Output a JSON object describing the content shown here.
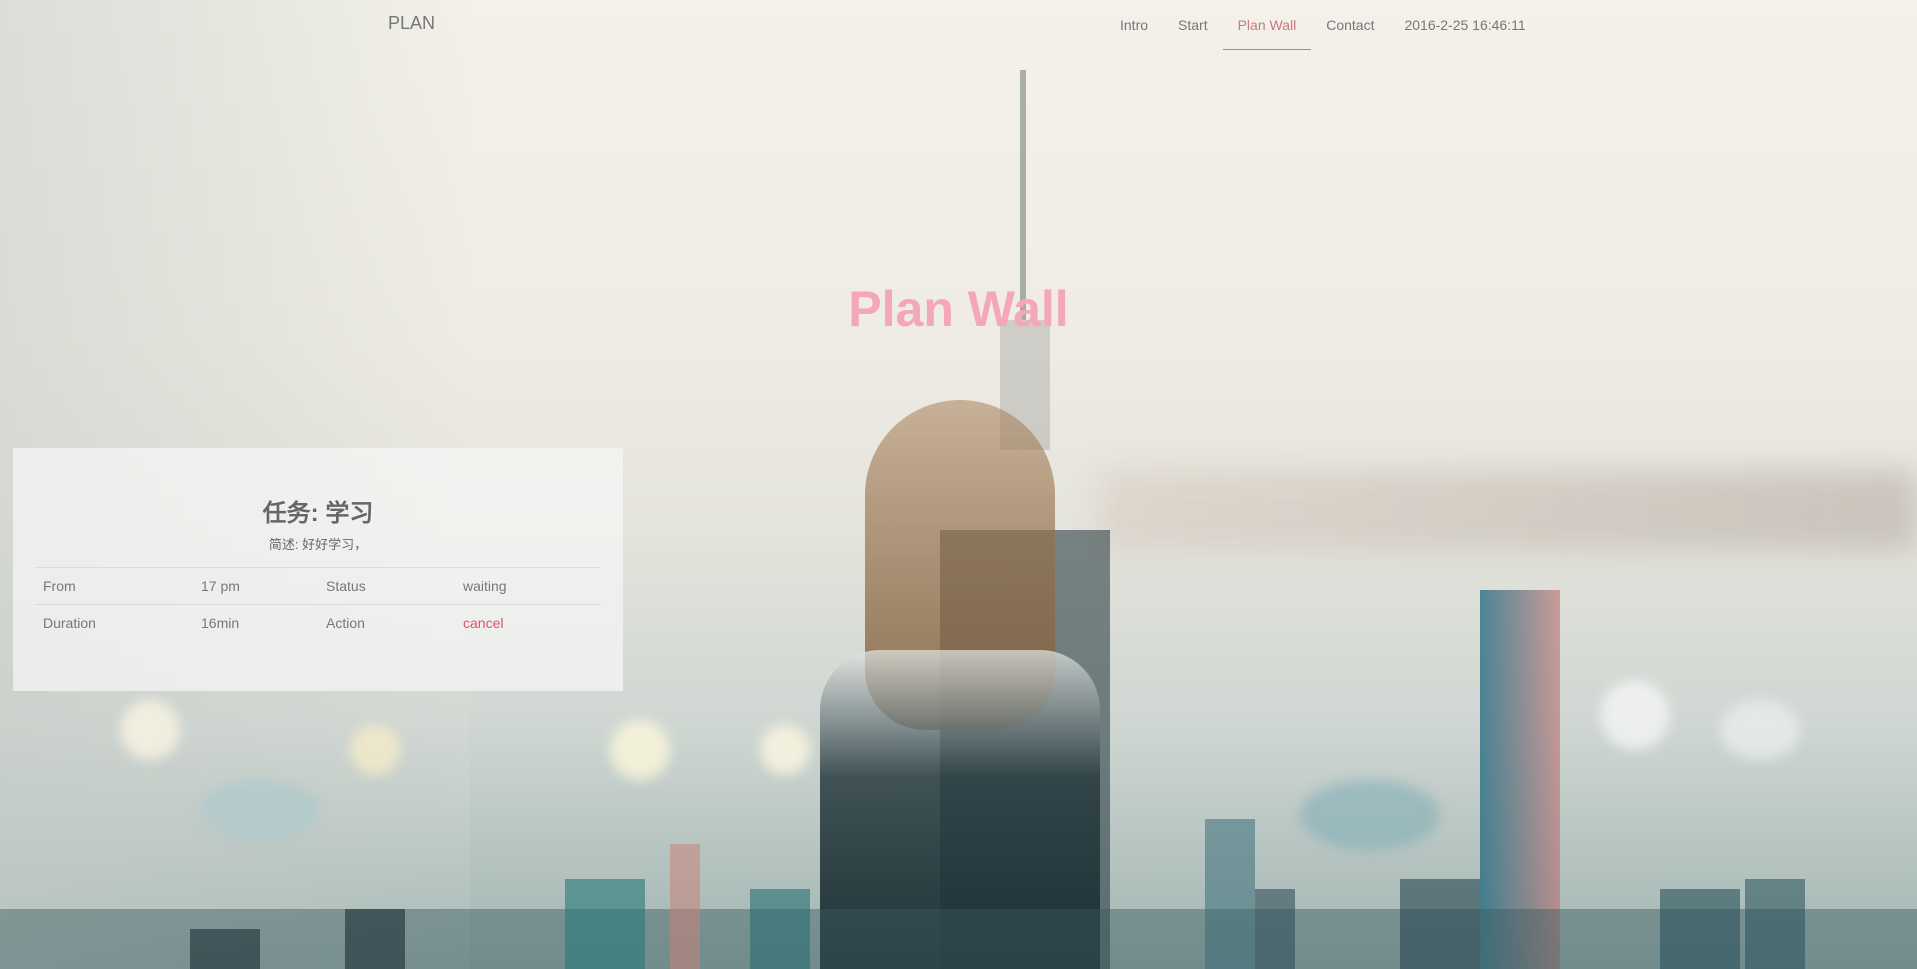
{
  "navbar": {
    "brand": "PLAN",
    "items": [
      {
        "label": "Intro",
        "active": false
      },
      {
        "label": "Start",
        "active": false
      },
      {
        "label": "Plan Wall",
        "active": true
      },
      {
        "label": "Contact",
        "active": false
      }
    ],
    "datetime": "2016-2-25 16:46:11"
  },
  "hero": {
    "title": "Plan Wall",
    "title_color": "#f4a7b9"
  },
  "task_card": {
    "title": "任务: 学习",
    "description": "简述: 好好学习，",
    "rows": [
      {
        "label1": "From",
        "value1": "17 pm",
        "label2": "Status",
        "value2": "waiting"
      },
      {
        "label1": "Duration",
        "value1": "16min",
        "label2": "Action",
        "value2": "cancel"
      }
    ]
  },
  "colors": {
    "nav_text": "#777777",
    "nav_active": "#c97a7a",
    "action_link": "#e0506b"
  }
}
